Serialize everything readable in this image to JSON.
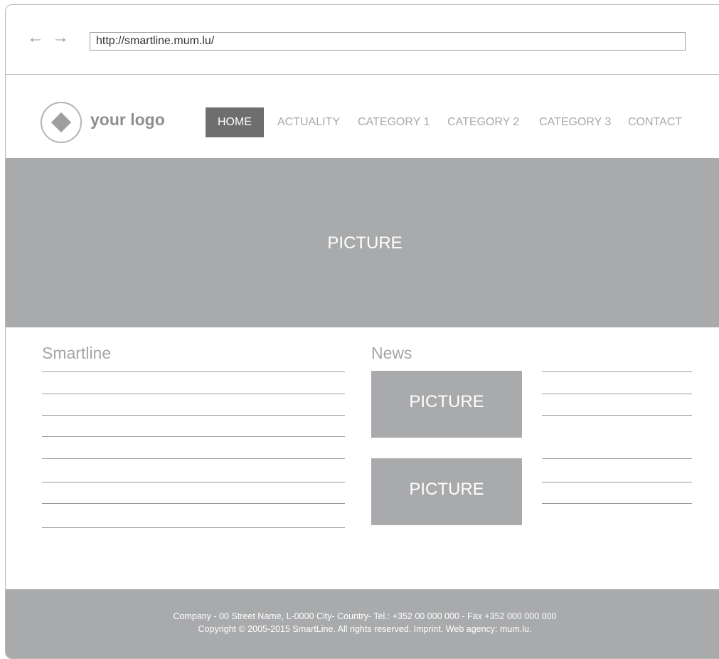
{
  "browser": {
    "back_icon": "←",
    "forward_icon": "→",
    "url": "http://smartline.mum.lu/"
  },
  "header": {
    "logo_text": "your logo",
    "menu": [
      "HOME",
      "ACTUALITY",
      "CATEGORY 1",
      "CATEGORY 2",
      "CATEGORY 3",
      "CONTACT"
    ],
    "active_item": "HOME"
  },
  "hero": {
    "label": "PICTURE"
  },
  "content": {
    "left_title": "Smartline",
    "right_title": "News",
    "news_items": [
      {
        "label": "PICTURE"
      },
      {
        "label": "PICTURE"
      }
    ]
  },
  "footer": {
    "line1": "Company - 00 Street Name, L-0000 City- Country-  Tel.: +352 00 000 000 - Fax  +352 000 000 000",
    "line2": "Copyright © 2005-2015 SmartLine.  All rights reserved. Imprint. Web agency: mum.lu."
  },
  "colors": {
    "placeholder_gray": "#a9aaac",
    "active_menu": "#6e6e6f",
    "menu_text": "#a8a8a8"
  }
}
